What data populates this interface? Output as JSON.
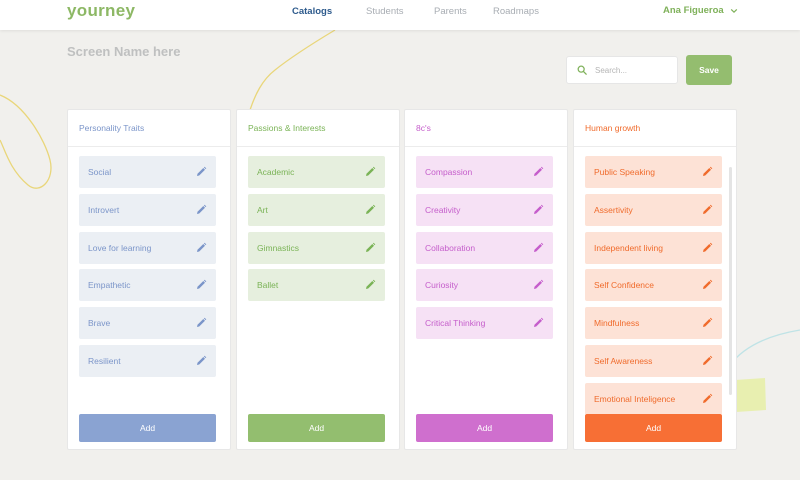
{
  "header": {
    "logo": "yourney",
    "nav": [
      {
        "label": "Catalogs",
        "active": true
      },
      {
        "label": "Students",
        "active": false
      },
      {
        "label": "Parents",
        "active": false
      },
      {
        "label": "Roadmaps",
        "active": false
      }
    ],
    "user_name": "Ana Figueroa"
  },
  "page": {
    "title": "Screen Name here",
    "search_placeholder": "Search...",
    "save_label": "Save"
  },
  "columns": [
    {
      "title": "Personality Traits",
      "accent": "#7b95c9",
      "item_bg": "#ebeff4",
      "button_color": "#8aa3d2",
      "add_label": "Add",
      "items": [
        "Social",
        "Introvert",
        "Love for learning",
        "Empathetic",
        "Brave",
        "Resilient"
      ]
    },
    {
      "title": "Passions & Interests",
      "accent": "#7ab356",
      "item_bg": "#e6efde",
      "button_color": "#93be6f",
      "add_label": "Add",
      "items": [
        "Academic",
        "Art",
        "Gimnastics",
        "Ballet"
      ]
    },
    {
      "title": "8c's",
      "accent": "#c55dcb",
      "item_bg": "#f6e1f5",
      "button_color": "#cf6fce",
      "add_label": "Add",
      "items": [
        "Compassion",
        "Creativity",
        "Collaboration",
        "Curiosity",
        "Critical Thinking"
      ]
    },
    {
      "title": "Human growth",
      "accent": "#f06b2c",
      "item_bg": "#fde2d6",
      "button_color": "#f76f35",
      "add_label": "Add",
      "items": [
        "Public Speaking",
        "Assertivity",
        "Independent living",
        "Self Confidence",
        "Mindfulness",
        "Self Awareness",
        "Emotional Inteligence"
      ]
    }
  ]
}
